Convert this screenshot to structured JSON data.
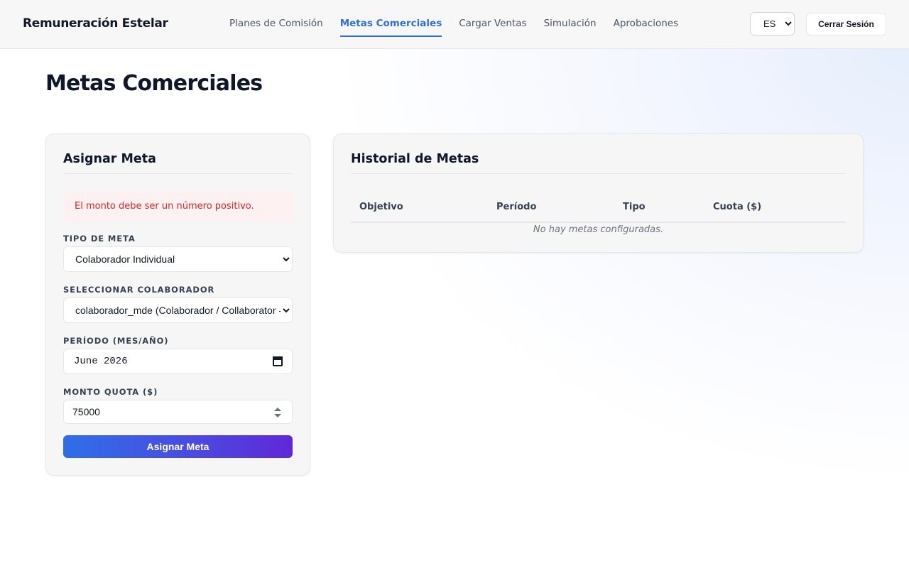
{
  "app": {
    "title": "Remuneración Estelar"
  },
  "nav": {
    "items": [
      {
        "label": "Planes de Comisión"
      },
      {
        "label": "Metas Comerciales",
        "active": true
      },
      {
        "label": "Cargar Ventas"
      },
      {
        "label": "Simulación"
      },
      {
        "label": "Aprobaciones"
      }
    ]
  },
  "header": {
    "language": {
      "selected": "ES",
      "options": [
        "ES"
      ]
    },
    "logout_label": "Cerrar Sesión"
  },
  "page": {
    "title": "Metas Comerciales"
  },
  "form": {
    "title": "Asignar Meta",
    "error_message": "El monto debe ser un número positivo.",
    "goal_type": {
      "label": "Tipo de Meta",
      "selected": "Colaborador Individual"
    },
    "collaborator": {
      "label": "Seleccionar Colaborador",
      "selected": "colaborador_mde (Colaborador / Collaborator - MDE)"
    },
    "period": {
      "label": "Período (Mes/Año)",
      "value": "June 2026"
    },
    "amount": {
      "label": "Monto Quota ($)",
      "value": "75000"
    },
    "submit_label": "Asignar Meta"
  },
  "history": {
    "title": "Historial de Metas",
    "columns": [
      "Objetivo",
      "Período",
      "Tipo",
      "Cuota ($)"
    ],
    "empty_message": "No hay metas configuradas."
  },
  "colors": {
    "accent": "#2f6fe0",
    "error": "#dc2626",
    "button_gradient_start": "#2f6fe8",
    "button_gradient_end": "#6028d8"
  },
  "icons": {
    "period_field": "calendar-icon",
    "amount_field": "spinner-icon",
    "selects": "chevron-down-icon"
  }
}
